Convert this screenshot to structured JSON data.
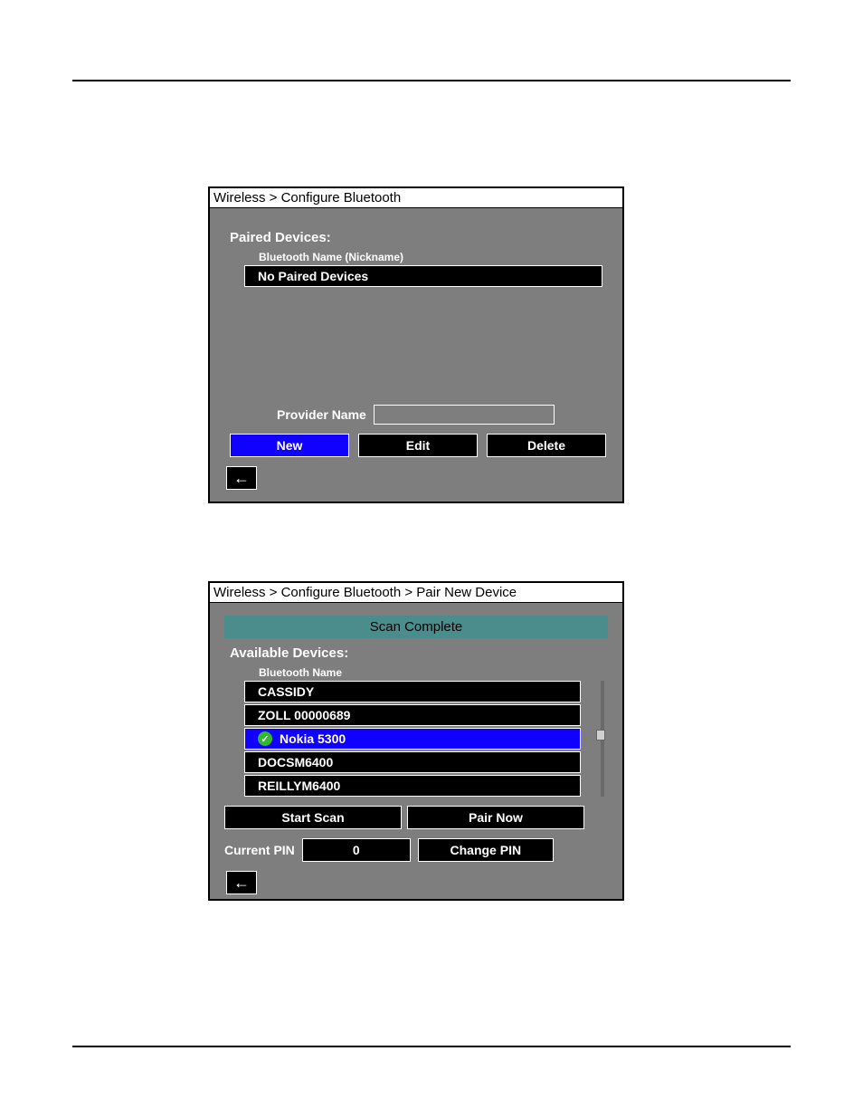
{
  "panel1": {
    "breadcrumb": "Wireless > Configure Bluetooth",
    "paired_devices_label": "Paired Devices:",
    "column_header": "Bluetooth Name (Nickname)",
    "empty_text": "No Paired Devices",
    "provider_label": "Provider Name",
    "provider_value": "",
    "buttons": {
      "new": "New",
      "edit": "Edit",
      "delete": "Delete"
    }
  },
  "panel2": {
    "breadcrumb": "Wireless > Configure Bluetooth > Pair New Device",
    "status_text": "Scan Complete",
    "available_label": "Available Devices:",
    "column_header": "Bluetooth Name",
    "devices": [
      {
        "name": "CASSIDY",
        "selected": false
      },
      {
        "name": "ZOLL 00000689",
        "selected": false
      },
      {
        "name": "Nokia 5300",
        "selected": true
      },
      {
        "name": "DOCSM6400",
        "selected": false
      },
      {
        "name": "REILLYM6400",
        "selected": false
      }
    ],
    "buttons": {
      "start_scan": "Start Scan",
      "pair_now": "Pair Now",
      "change_pin": "Change PIN"
    },
    "pin_label": "Current PIN",
    "pin_value": "0"
  },
  "icons": {
    "back": "←",
    "check": "✓"
  }
}
